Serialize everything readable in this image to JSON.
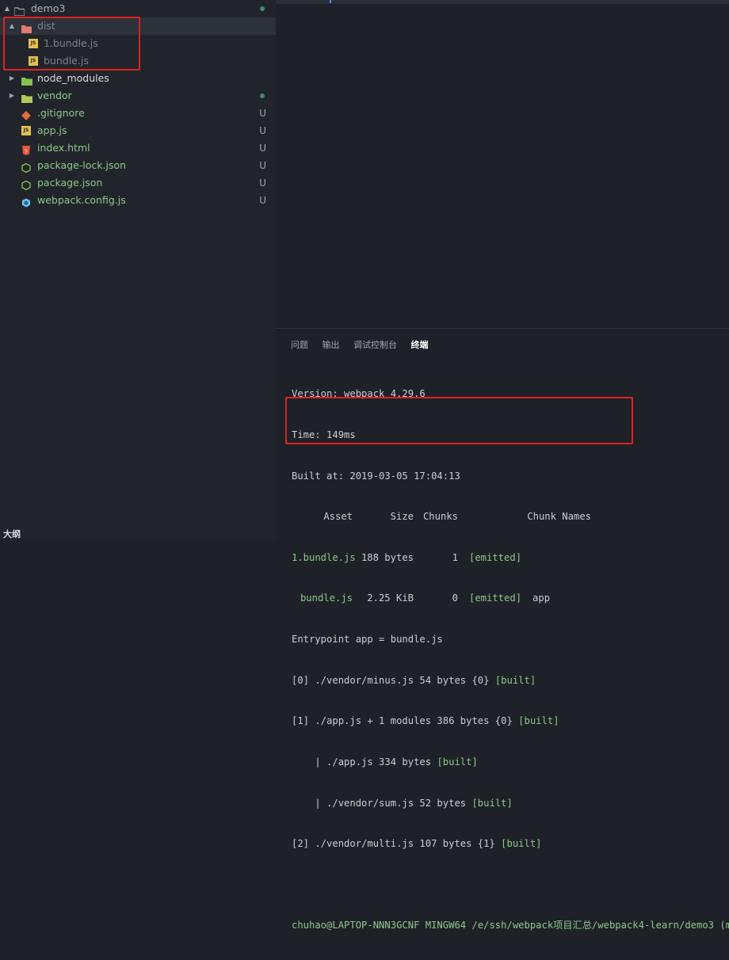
{
  "sidebar": {
    "root": {
      "label": "demo3"
    },
    "dist": {
      "label": "dist",
      "files": [
        "1.bundle.js",
        "bundle.js"
      ]
    },
    "items": [
      {
        "label": "node_modules",
        "status": ""
      },
      {
        "label": "vendor",
        "status": ""
      },
      {
        "label": ".gitignore",
        "status": "U"
      },
      {
        "label": "app.js",
        "status": "U"
      },
      {
        "label": "index.html",
        "status": "U"
      },
      {
        "label": "package-lock.json",
        "status": "U"
      },
      {
        "label": "package.json",
        "status": "U"
      },
      {
        "label": "webpack.config.js",
        "status": "U"
      }
    ],
    "outline_label": "大纲"
  },
  "panel": {
    "tabs": [
      "问题",
      "输出",
      "调试控制台",
      "终端"
    ],
    "active_tab": "终端"
  },
  "terminal": {
    "version": "Version: webpack 4.29.6",
    "time": "Time: 149ms",
    "built": "Built at: 2019-03-05 17:04:13",
    "headers": {
      "asset": "Asset",
      "size": "Size",
      "chunks": "Chunks",
      "chunk_names": "Chunk Names"
    },
    "rows": [
      {
        "asset": "1.bundle.js",
        "size": "188 bytes",
        "chunks": "1",
        "status": "[emitted]",
        "names": ""
      },
      {
        "asset": "bundle.js",
        "size": "2.25 KiB",
        "chunks": "0",
        "status": "[emitted]",
        "names": "app"
      }
    ],
    "entrypoint": "Entrypoint app = bundle.js",
    "modules": [
      {
        "prefix": "[0] ./vendor/minus.js 54 bytes {0} ",
        "tag": "[built]"
      },
      {
        "prefix": "[1] ./app.js + 1 modules 386 bytes {0} ",
        "tag": "[built]"
      },
      {
        "prefix": "    | ./app.js 334 bytes ",
        "tag": "[built]"
      },
      {
        "prefix": "    | ./vendor/sum.js 52 bytes ",
        "tag": "[built]"
      },
      {
        "prefix": "[2] ./vendor/multi.js 107 bytes {1} ",
        "tag": "[built]"
      }
    ],
    "prompt": "chuhao@LAPTOP-NNN3GCNF MINGW64 /e/ssh/webpack项目汇总/webpack4-learn/demo3 (m"
  },
  "colors": {
    "accent_green": "#8cc88a",
    "highlight_red": "#e02020",
    "status_dot": "#3b8e6d"
  }
}
